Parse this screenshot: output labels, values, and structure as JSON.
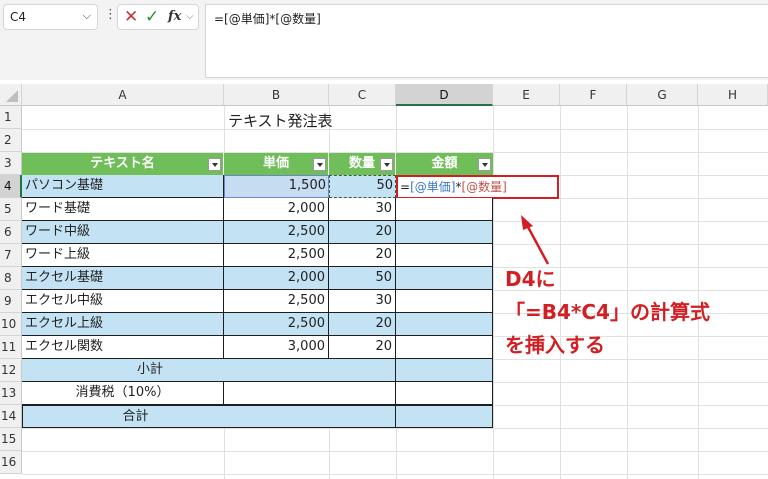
{
  "formula_bar": {
    "name_box": "C4",
    "name_box_arrow": "⌵",
    "kebab": "⋮",
    "cancel": "✕",
    "enter": "✓",
    "fx": "fx",
    "fx_arrow": "⌵",
    "formula": "=[@単価]*[@数量]"
  },
  "columns": [
    "A",
    "B",
    "C",
    "D",
    "E",
    "F",
    "G",
    "H"
  ],
  "rows": [
    "1",
    "2",
    "3",
    "4",
    "5",
    "6",
    "7",
    "8",
    "9",
    "10",
    "11",
    "12",
    "13",
    "14",
    "15",
    "16"
  ],
  "title": "テキスト発注表",
  "table": {
    "headers": [
      "テキスト名",
      "単価",
      "数量",
      "金額"
    ],
    "rows": [
      {
        "name": "パソコン基礎",
        "price": "1,500",
        "qty": "50"
      },
      {
        "name": "ワード基礎",
        "price": "2,000",
        "qty": "30"
      },
      {
        "name": "ワード中級",
        "price": "2,500",
        "qty": "20"
      },
      {
        "name": "ワード上級",
        "price": "2,500",
        "qty": "20"
      },
      {
        "name": "エクセル基礎",
        "price": "2,000",
        "qty": "50"
      },
      {
        "name": "エクセル中級",
        "price": "2,500",
        "qty": "30"
      },
      {
        "name": "エクセル上級",
        "price": "2,500",
        "qty": "20"
      },
      {
        "name": "エクセル関数",
        "price": "3,000",
        "qty": "20"
      }
    ],
    "subtotal_label": "小計",
    "tax_label": "消費税（10%）",
    "total_label": "合計"
  },
  "d4_formula": {
    "eq": "=",
    "ref_a": "[@単価]",
    "op": "*",
    "ref_b": "[@数量]"
  },
  "callout": {
    "line1": "D4に",
    "line2": "「=B4*C4」の計算式",
    "line3": "を挿入する"
  },
  "colors": {
    "header_green": "#6fbe5a",
    "band_blue": "#c3e3f5",
    "callout_red": "#d11f24",
    "excel_green": "#217346"
  },
  "icons": {
    "cancel": "close-icon",
    "enter": "check-icon",
    "fx": "function-icon",
    "dropdown": "filter-dropdown-icon"
  }
}
